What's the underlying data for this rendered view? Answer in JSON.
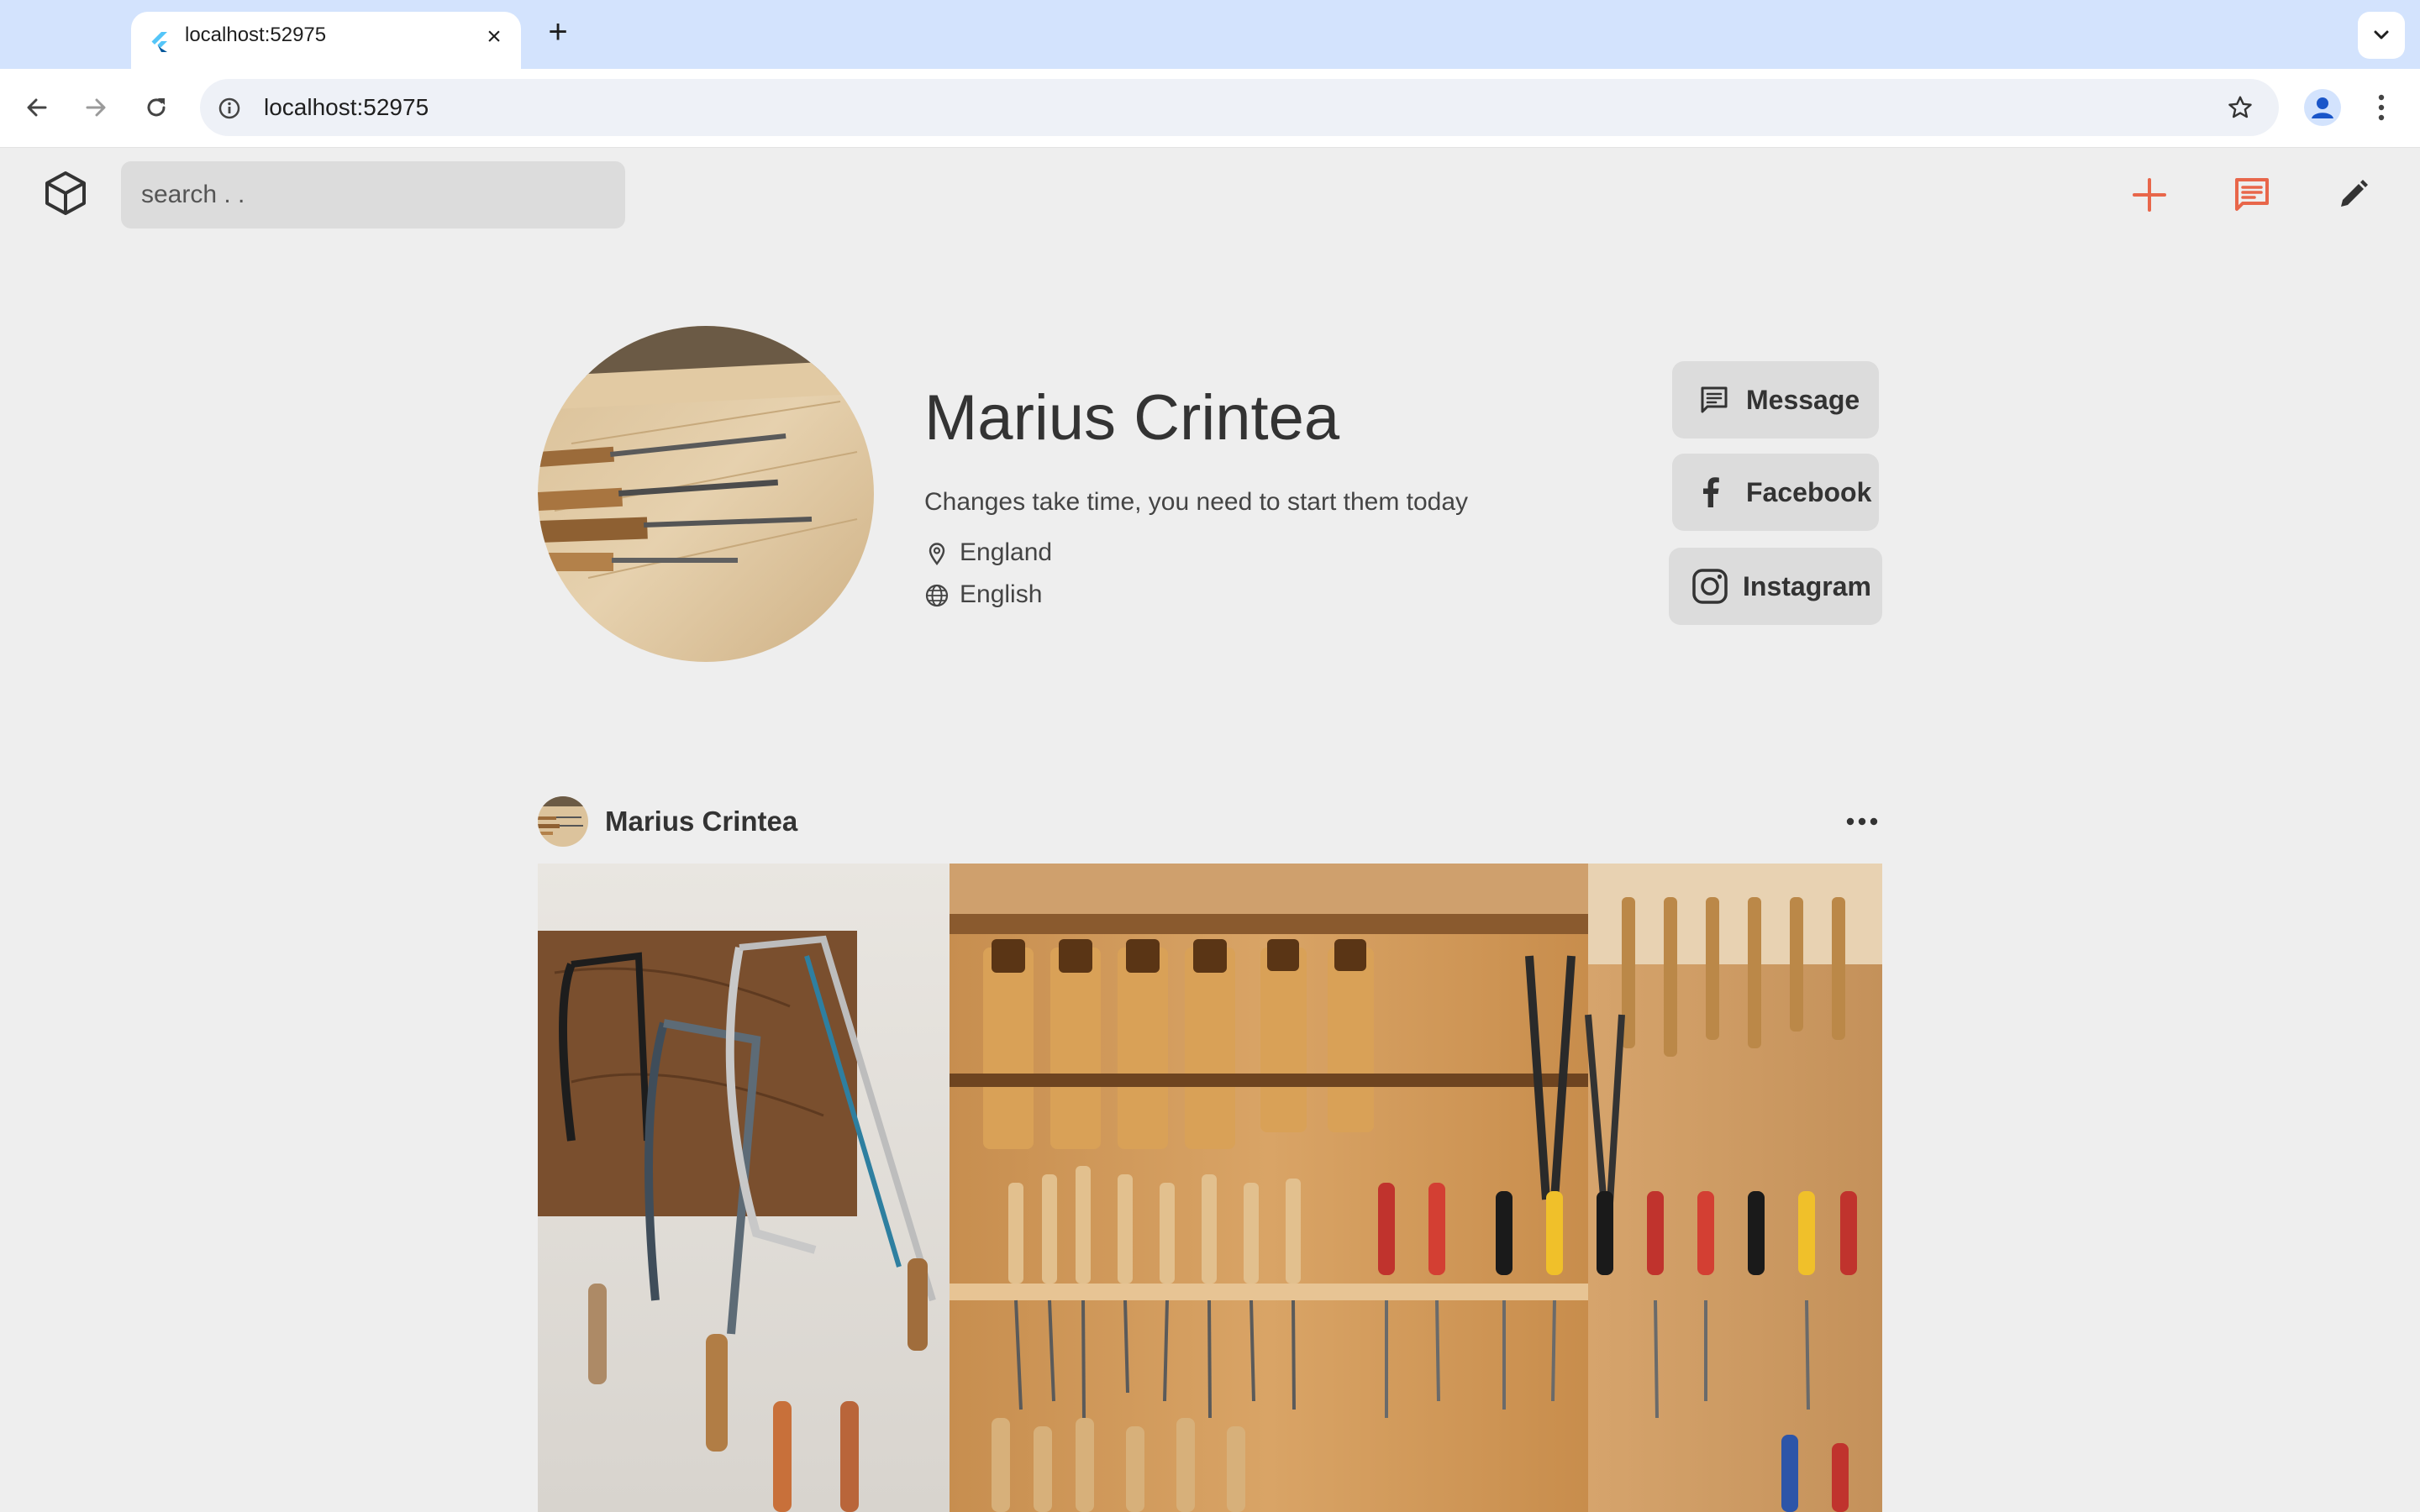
{
  "browser": {
    "tab_title": "localhost:52975",
    "url": "localhost:52975",
    "new_tab_symbol": "+",
    "close_symbol": "×"
  },
  "app": {
    "search_placeholder": "search . .",
    "accent_color": "#e8664a",
    "icons": [
      "cube-logo-icon",
      "plus-icon",
      "chat-icon",
      "pencil-icon"
    ]
  },
  "profile": {
    "name": "Marius Crintea",
    "bio": "Changes take time, you need to start them today",
    "location": "England",
    "language": "English",
    "buttons": {
      "message": "Message",
      "facebook": "Facebook",
      "instagram": "Instagram"
    }
  },
  "post": {
    "author": "Marius Crintea"
  }
}
